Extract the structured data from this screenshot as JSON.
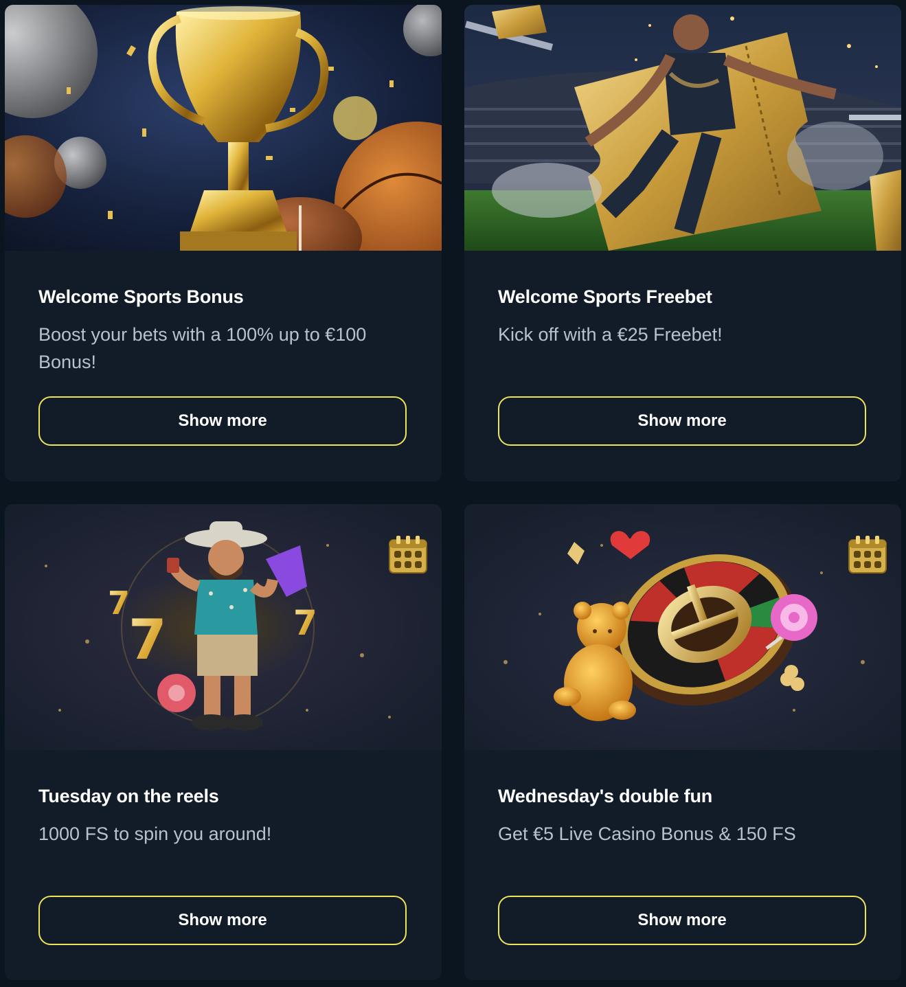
{
  "promotions": [
    {
      "title": "Welcome Sports Bonus",
      "description": "Boost your bets with a 100% up to €100 Bonus!",
      "button_label": "Show more",
      "image": "trophy-with-balls-banner"
    },
    {
      "title": "Welcome Sports Freebet",
      "description": "Kick off with a €25 Freebet!",
      "button_label": "Show more",
      "image": "football-player-golden-ticket-banner"
    },
    {
      "title": "Tuesday on the reels",
      "description": "1000 FS to spin you around!",
      "button_label": "Show more",
      "image": "cowboy-slot-character-banner",
      "icon": "calendar-icon"
    },
    {
      "title": "Wednesday's double fun",
      "description": "Get €5 Live Casino Bonus & 150 FS",
      "button_label": "Show more",
      "image": "roulette-wheel-gummy-bear-banner",
      "icon": "calendar-icon"
    }
  ],
  "colors": {
    "page_background": "#0b1520",
    "card_background": "#111c28",
    "button_border": "#f0e35a",
    "title_text": "#ffffff",
    "description_text": "#b9c2cc"
  }
}
